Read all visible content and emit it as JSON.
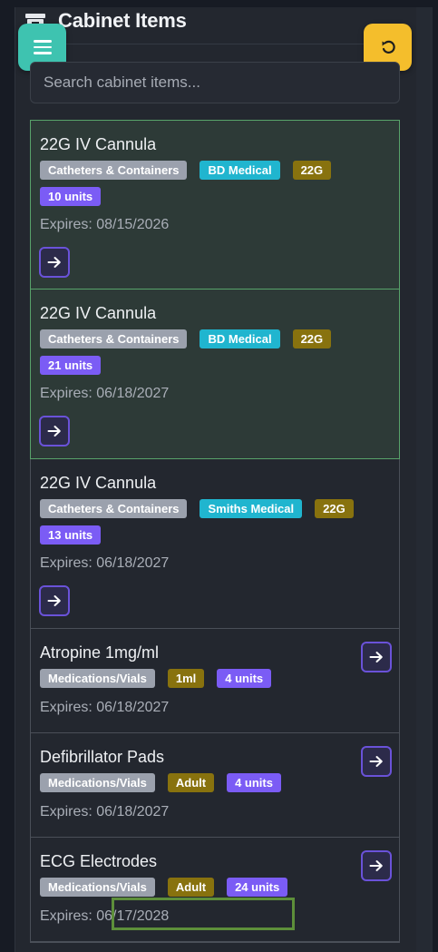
{
  "header": {
    "title": "Cabinet Items"
  },
  "search": {
    "placeholder": "Search cabinet items..."
  },
  "items": [
    {
      "name": "22G IV Cannula",
      "badges": [
        "Catheters & Containers",
        "BD Medical",
        "22G",
        "10 units"
      ],
      "expires": "Expires: 08/15/2026",
      "selected": true
    },
    {
      "name": "22G IV Cannula",
      "badges": [
        "Catheters & Containers",
        "BD Medical",
        "22G",
        "21 units"
      ],
      "expires": "Expires: 06/18/2027",
      "selected": true
    },
    {
      "name": "22G IV Cannula",
      "badges": [
        "Catheters & Containers",
        "Smiths Medical",
        "22G",
        "13 units"
      ],
      "expires": "Expires: 06/18/2027",
      "selected": false
    },
    {
      "name": "Atropine 1mg/ml",
      "badges": [
        "Medications/Vials",
        "1ml",
        "4 units"
      ],
      "expires": "Expires: 06/18/2027",
      "selected": false
    },
    {
      "name": "Defibrillator Pads",
      "badges": [
        "Medications/Vials",
        "Adult",
        "4 units"
      ],
      "expires": "Expires: 06/18/2027",
      "selected": false
    },
    {
      "name": "ECG Electrodes",
      "badges": [
        "Medications/Vials",
        "Adult",
        "24 units"
      ],
      "expires": "Expires: 06/17/2028",
      "selected": false
    }
  ],
  "colors": {
    "menu_button": "#3ec3b0",
    "undo_button": "#f4be2c",
    "category_badge": "#9ba1ad",
    "manufacturer_badge": "#20b5cf",
    "size_badge": "#88720e",
    "quantity_badge": "#7b5cf5",
    "selected_border": "#58a36a",
    "annotation_box": "#5d8f3a"
  },
  "icons": {
    "menu": "hamburger-icon",
    "undo": "undo-icon",
    "header": "archive-icon",
    "go": "arrow-right-icon"
  }
}
